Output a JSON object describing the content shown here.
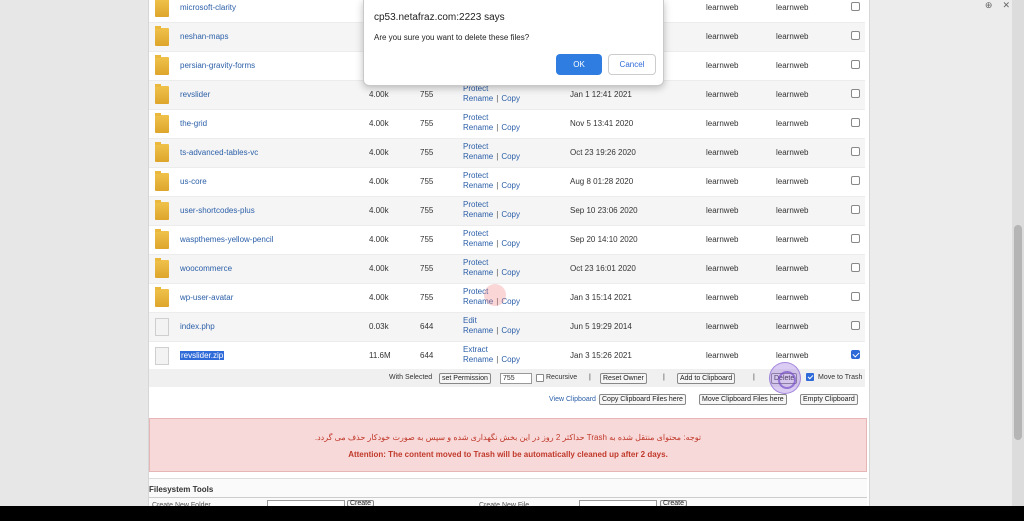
{
  "dialog": {
    "title": "cp53.netafraz.com:2223 says",
    "message": "Are you sure you want to delete these files?",
    "ok_label": "OK",
    "cancel_label": "Cancel"
  },
  "files": [
    {
      "name": "microsoft-clarity",
      "type": "folder",
      "size": "",
      "perm": "",
      "action1": "",
      "action2a": "",
      "action2b": "",
      "date": "",
      "user": "learnweb",
      "group": "learnweb",
      "checked": false
    },
    {
      "name": "neshan-maps",
      "type": "folder",
      "size": "",
      "perm": "",
      "action1": "",
      "action2a": "",
      "action2b": "",
      "date": "",
      "user": "learnweb",
      "group": "learnweb",
      "checked": false
    },
    {
      "name": "persian-gravity-forms",
      "type": "folder",
      "size": "",
      "perm": "",
      "action1": "",
      "action2a": "",
      "action2b": "",
      "date": "",
      "user": "learnweb",
      "group": "learnweb",
      "checked": false
    },
    {
      "name": "revslider",
      "type": "folder",
      "size": "4.00k",
      "perm": "755",
      "action1": "Protect",
      "action2a": "Rename",
      "action2b": "Copy",
      "date": "Jan 1 12:41 2021",
      "user": "learnweb",
      "group": "learnweb",
      "checked": false
    },
    {
      "name": "the-grid",
      "type": "folder",
      "size": "4.00k",
      "perm": "755",
      "action1": "Protect",
      "action2a": "Rename",
      "action2b": "Copy",
      "date": "Nov 5 13:41 2020",
      "user": "learnweb",
      "group": "learnweb",
      "checked": false
    },
    {
      "name": "ts-advanced-tables-vc",
      "type": "folder",
      "size": "4.00k",
      "perm": "755",
      "action1": "Protect",
      "action2a": "Rename",
      "action2b": "Copy",
      "date": "Oct 23 19:26 2020",
      "user": "learnweb",
      "group": "learnweb",
      "checked": false
    },
    {
      "name": "us-core",
      "type": "folder",
      "size": "4.00k",
      "perm": "755",
      "action1": "Protect",
      "action2a": "Rename",
      "action2b": "Copy",
      "date": "Aug 8 01:28 2020",
      "user": "learnweb",
      "group": "learnweb",
      "checked": false
    },
    {
      "name": "user-shortcodes-plus",
      "type": "folder",
      "size": "4.00k",
      "perm": "755",
      "action1": "Protect",
      "action2a": "Rename",
      "action2b": "Copy",
      "date": "Sep 10 23:06 2020",
      "user": "learnweb",
      "group": "learnweb",
      "checked": false
    },
    {
      "name": "waspthemes-yellow-pencil",
      "type": "folder",
      "size": "4.00k",
      "perm": "755",
      "action1": "Protect",
      "action2a": "Rename",
      "action2b": "Copy",
      "date": "Sep 20 14:10 2020",
      "user": "learnweb",
      "group": "learnweb",
      "checked": false
    },
    {
      "name": "woocommerce",
      "type": "folder",
      "size": "4.00k",
      "perm": "755",
      "action1": "Protect",
      "action2a": "Rename",
      "action2b": "Copy",
      "date": "Oct 23 16:01 2020",
      "user": "learnweb",
      "group": "learnweb",
      "checked": false
    },
    {
      "name": "wp-user-avatar",
      "type": "folder",
      "size": "4.00k",
      "perm": "755",
      "action1": "Protect",
      "action2a": "Rename",
      "action2b": "Copy",
      "date": "Jan 3 15:14 2021",
      "user": "learnweb",
      "group": "learnweb",
      "checked": false
    },
    {
      "name": "index.php",
      "type": "file",
      "size": "0.03k",
      "perm": "644",
      "action1": "Edit",
      "action2a": "Rename",
      "action2b": "Copy",
      "date": "Jun 5 19:29 2014",
      "user": "learnweb",
      "group": "learnweb",
      "checked": false
    },
    {
      "name": "revslider.zip",
      "type": "file",
      "size": "11.6M",
      "perm": "644",
      "action1": "Extract",
      "action2a": "Rename",
      "action2b": "Copy",
      "date": "Jan 3 15:26 2021",
      "user": "learnweb",
      "group": "learnweb",
      "checked": true,
      "selected": true
    }
  ],
  "toolbar": {
    "with_selected": "With Selected",
    "set_permission": "set Permission",
    "permission_value": "755",
    "recursive": "Recursive",
    "reset_owner": "Reset Owner",
    "add_to_clipboard": "Add to Clipboard",
    "delete": "Delete",
    "move_to_trash": "Move to Trash",
    "separator": "|"
  },
  "clipboard": {
    "view": "View Clipboard",
    "copy_here": "Copy Clipboard Files here",
    "move_here": "Move Clipboard Files here",
    "empty": "Empty Clipboard"
  },
  "notice": {
    "fa": "توجه: محتوای منتقل شده به Trash حداکثر 2 روز در این بخش نگهداری شده و سپس به صورت خودکار حذف می گردد.",
    "en": "Attention: The content moved to Trash will be automatically cleaned up after 2 days."
  },
  "filesystem": {
    "title": "Filesystem Tools",
    "new_folder": "Create New Folder",
    "new_file": "Create New File",
    "create": "Create"
  },
  "colors": {
    "link": "#2b5fa8",
    "accent": "#2f7de1",
    "notice_bg": "#f8d9d9",
    "notice_text": "#c0392b"
  }
}
